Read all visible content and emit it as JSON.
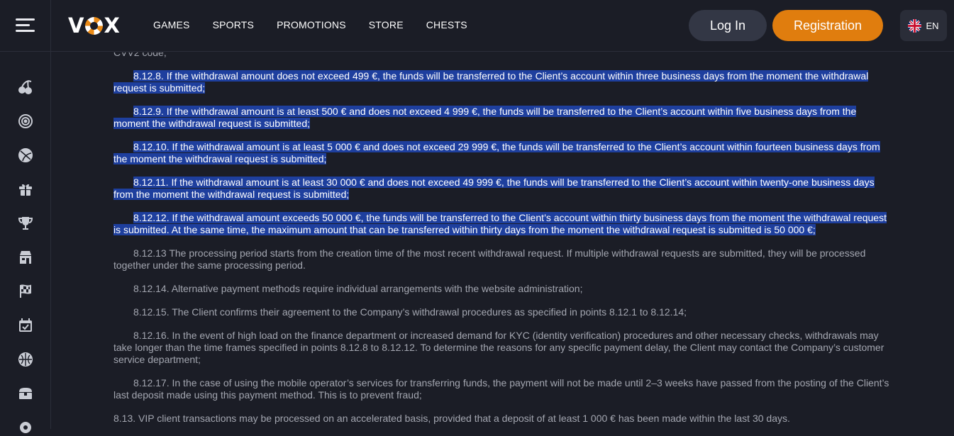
{
  "header": {
    "logo_text_left": "V",
    "logo_text_right": "X",
    "nav": [
      "GAMES",
      "SPORTS",
      "PROMOTIONS",
      "STORE",
      "CHESTS"
    ],
    "login_label": "Log In",
    "register_label": "Registration",
    "lang_label": "EN"
  },
  "sidebar": {
    "icons": [
      "cherries-icon",
      "target-icon",
      "basketball-icon",
      "gift-icon",
      "trophy-icon",
      "store-icon",
      "racing-flag-icon",
      "calendar-check-icon",
      "sports-ball-icon",
      "treasure-chest-icon",
      "settings-icon"
    ]
  },
  "content": {
    "top_clipped": "CVV2 code;",
    "paragraphs": [
      {
        "text": "8.12.8. If the withdrawal amount does not exceed 499 €, the funds will be transferred to the Client’s account within three business days from the moment the withdrawal request is submitted;",
        "selected": true
      },
      {
        "text": "8.12.9. If the withdrawal amount is at least 500 € and does not exceed 4 999 €, the funds will be transferred to the Client’s account within five business days from the moment the withdrawal request is submitted;",
        "selected": true
      },
      {
        "text": "8.12.10. If the withdrawal amount is at least 5 000 € and does not exceed 29 999 €, the funds will be transferred to the Client’s account within fourteen business days from the moment the withdrawal request is submitted;",
        "selected": true
      },
      {
        "text": "8.12.11. If the withdrawal amount is at least 30 000 € and does not exceed 49 999 €, the funds will be transferred to the Client’s account within twenty-one business days from the moment the withdrawal request is submitted;",
        "selected": true
      },
      {
        "text": "8.12.12. If the withdrawal amount exceeds 50 000 €, the funds will be transferred to the Client’s account within thirty business days from the moment the withdrawal request is submitted. At the same time, the maximum amount that can be transferred within thirty days from the moment the withdrawal request is submitted is 50 000 €;",
        "selected": true
      },
      {
        "text": "8.12.13 The processing period starts from the creation time of the most recent withdrawal request. If multiple withdrawal requests are submitted, they will be processed together under the same processing period.",
        "selected": false
      },
      {
        "text": "8.12.14. Alternative payment methods require individual arrangements with the website administration;",
        "selected": false
      },
      {
        "text": "8.12.15. The Client confirms their agreement to the Company’s withdrawal procedures as specified in points 8.12.1 to 8.12.14;",
        "selected": false
      },
      {
        "text": "8.12.16. In the event of high load on the finance department or increased demand for KYC (identity verification) procedures and other necessary checks, withdrawals may take longer than the time frames specified in points 8.12.8 to 8.12.12. To determine the reasons for any specific payment delay, the Client may contact the Company’s customer service department;",
        "selected": false
      },
      {
        "text": "8.12.17. In the case of using the mobile operator’s services for transferring funds, the payment will not be made until 2–3 weeks have passed from the posting of the Client’s last deposit made using this payment method. This is to prevent fraud;",
        "selected": false
      }
    ],
    "last_line": "8.13. VIP client transactions may be processed on an accelerated basis, provided that a deposit of at least 1 000 € has been made within the last 30 days."
  }
}
